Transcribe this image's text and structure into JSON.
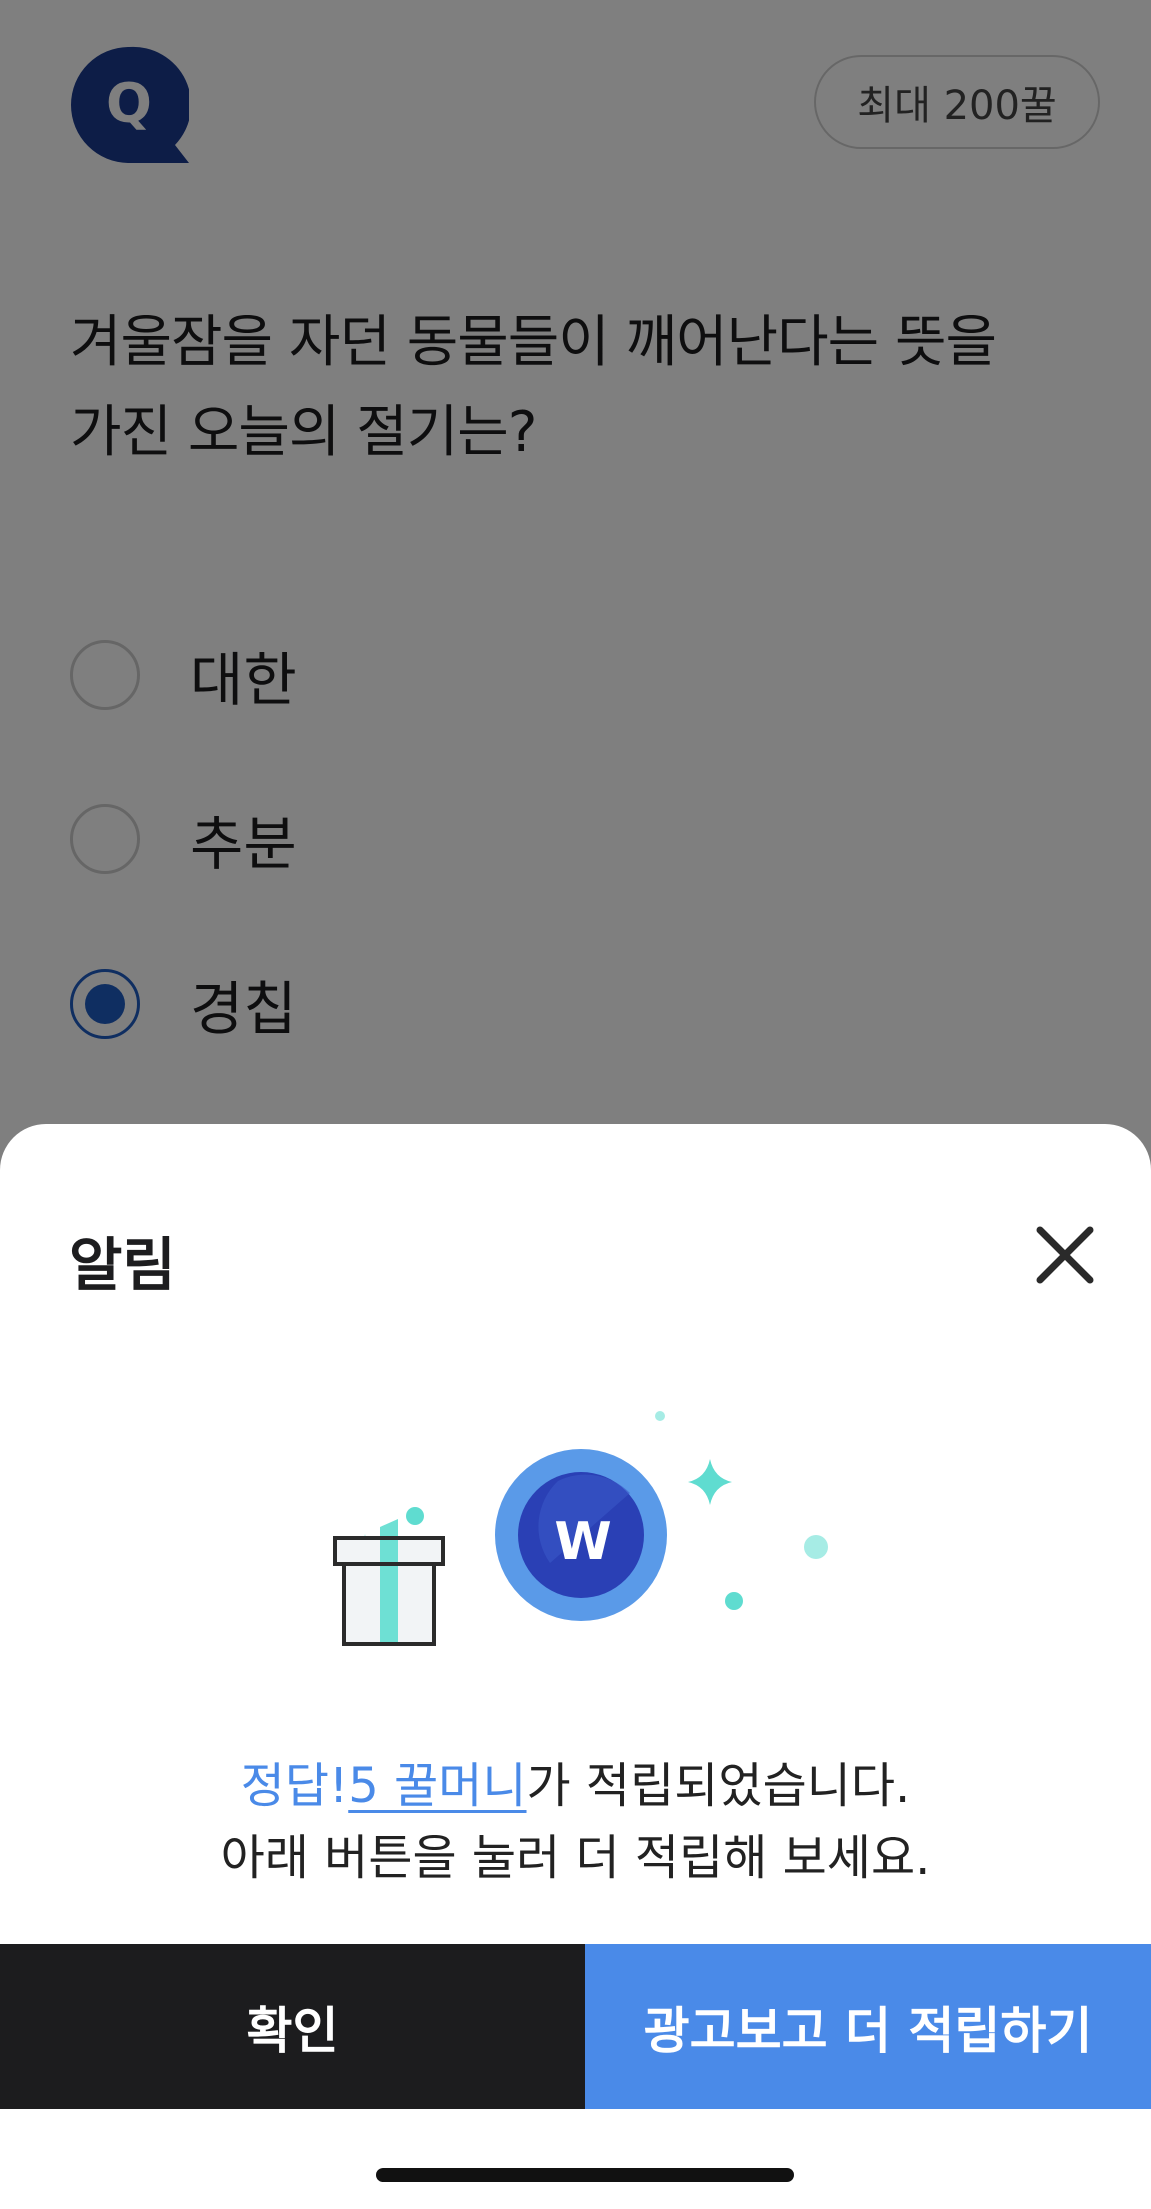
{
  "quiz": {
    "badge_letter": "Q",
    "max_points": "최대 200꿀",
    "question_lines": [
      "겨울잠을 자던 동물들이 깨어난다는 뜻을",
      "가진 오늘의 절기는?"
    ],
    "options": [
      {
        "label": "대한",
        "selected": false
      },
      {
        "label": "추분",
        "selected": false
      },
      {
        "label": "경칩",
        "selected": true
      }
    ]
  },
  "sheet": {
    "title": "알림",
    "close_icon": "close-icon",
    "illustration": {
      "coin_letter": "W",
      "icon": "gift-coin-illustration"
    },
    "message": {
      "correct": "정답!",
      "reward": "5 꿀머니",
      "rest_line1": "가 적립되었습니다.",
      "line2": "아래 버튼을 눌러 더 적립해 보세요."
    },
    "buttons": {
      "confirm": "확인",
      "watch_ad": "광고보고 더 적립하기"
    }
  },
  "colors": {
    "accent": "#4a8ae8",
    "navy": "#1a3a8f",
    "mint": "#5fdcd0",
    "dark_button": "#1c1c1e"
  }
}
